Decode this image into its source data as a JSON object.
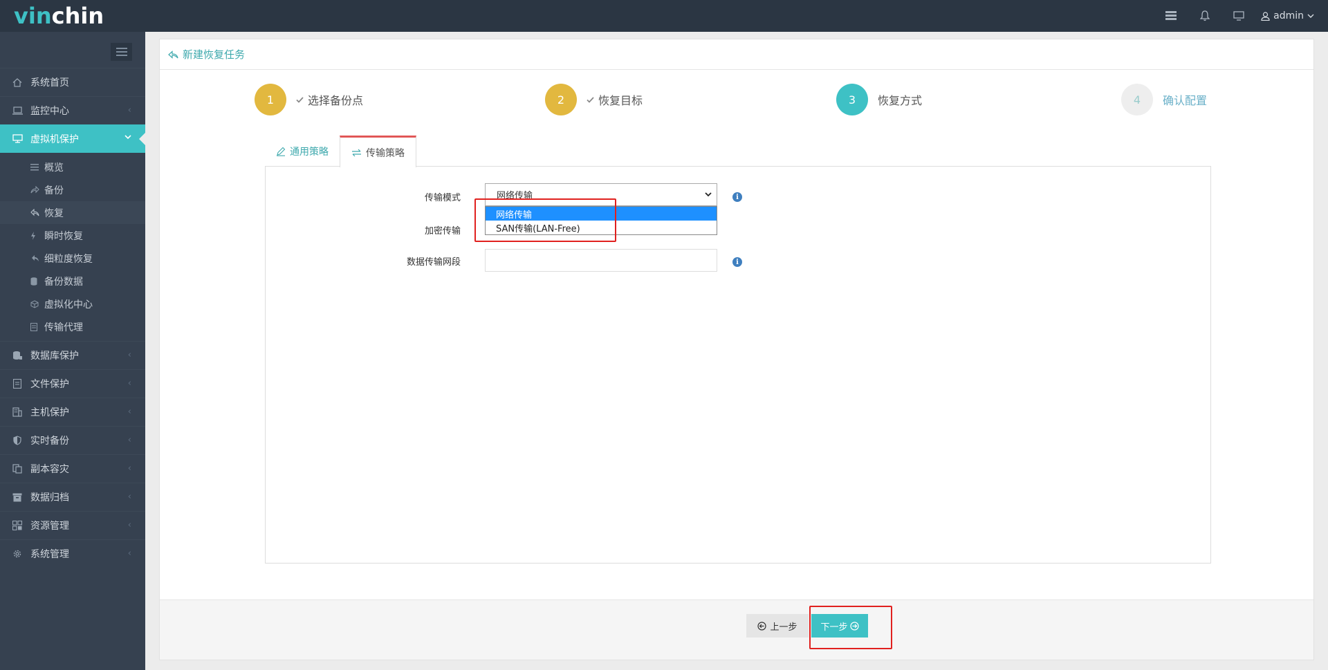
{
  "logo": {
    "part1": "vin",
    "part2": "chin"
  },
  "topbar": {
    "user": "admin"
  },
  "sidebar": {
    "items": [
      {
        "label": "系统首页"
      },
      {
        "label": "监控中心"
      },
      {
        "label": "虚拟机保护"
      },
      {
        "label": "数据库保护"
      },
      {
        "label": "文件保护"
      },
      {
        "label": "主机保护"
      },
      {
        "label": "实时备份"
      },
      {
        "label": "副本容灾"
      },
      {
        "label": "数据归档"
      },
      {
        "label": "资源管理"
      },
      {
        "label": "系统管理"
      }
    ],
    "sub_items": [
      {
        "label": "概览"
      },
      {
        "label": "备份"
      },
      {
        "label": "恢复"
      },
      {
        "label": "瞬时恢复"
      },
      {
        "label": "细粒度恢复"
      },
      {
        "label": "备份数据"
      },
      {
        "label": "虚拟化中心"
      },
      {
        "label": "传输代理"
      }
    ]
  },
  "panel": {
    "title": "新建恢复任务"
  },
  "steps": [
    {
      "num": "1",
      "label": "选择备份点"
    },
    {
      "num": "2",
      "label": "恢复目标"
    },
    {
      "num": "3",
      "label": "恢复方式"
    },
    {
      "num": "4",
      "label": "确认配置"
    }
  ],
  "tabs": [
    {
      "label": "通用策略"
    },
    {
      "label": "传输策略"
    }
  ],
  "form": {
    "transfer_mode_label": "传输模式",
    "transfer_mode_value": "网络传输",
    "encrypt_label": "加密传输",
    "segment_label": "数据传输网段",
    "segment_value": "",
    "options": [
      "网络传输",
      "SAN传输(LAN-Free)"
    ]
  },
  "footer": {
    "prev_label": "上一步",
    "next_label": "下一步"
  },
  "colors": {
    "accent": "#3ec1c5",
    "done": "#e2b83f",
    "sidebar": "#364150",
    "topbar": "#2b3643",
    "highlight": "#e0201e"
  }
}
